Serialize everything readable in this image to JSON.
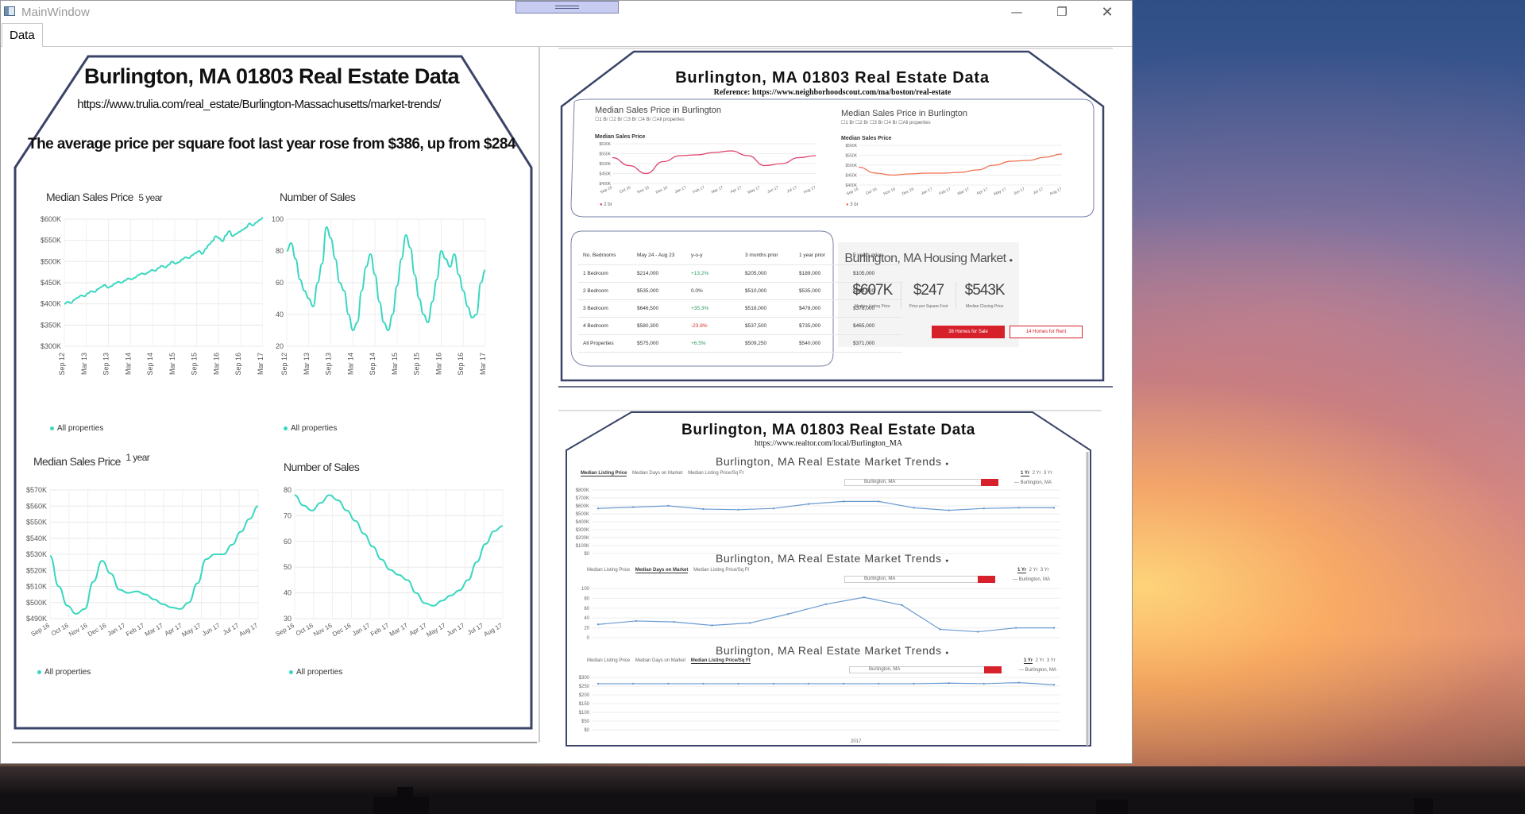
{
  "window": {
    "title": "MainWindow"
  },
  "tabs": [
    {
      "label": "Data"
    }
  ],
  "trulia": {
    "title": "Burlington, MA 01803 Real Estate Data",
    "url": "https://www.trulia.com/real_estate/Burlington-Massachusetts/market-trends/",
    "headline": "The average price per square foot last year rose from  $386, up from $284",
    "legend": "All properties",
    "charts": [
      {
        "title": "Median Sales Price",
        "subtitle": "5 year",
        "yticks": [
          "$600K",
          "$550K",
          "$500K",
          "$450K",
          "$400K",
          "$350K",
          "$300K"
        ],
        "xticks": [
          "Sep 12",
          "Mar 13",
          "Sep 13",
          "Mar 14",
          "Sep 14",
          "Mar 15",
          "Sep 15",
          "Mar 16",
          "Sep 16",
          "Mar 17"
        ]
      },
      {
        "title": "Number of Sales",
        "subtitle": "",
        "yticks": [
          "100",
          "80",
          "60",
          "40",
          "20"
        ],
        "xticks": [
          "Sep 12",
          "Mar 13",
          "Sep 13",
          "Mar 14",
          "Sep 14",
          "Mar 15",
          "Sep 15",
          "Mar 16",
          "Sep 16",
          "Mar 17"
        ]
      },
      {
        "title": "Median Sales Price",
        "subtitle": "1 year",
        "yticks": [
          "$570K",
          "$560K",
          "$550K",
          "$540K",
          "$530K",
          "$520K",
          "$510K",
          "$500K",
          "$490K"
        ],
        "xticks": [
          "Sep 16",
          "Oct 16",
          "Nov 16",
          "Dec 16",
          "Jan 17",
          "Feb 17",
          "Mar 17",
          "Apr 17",
          "May 17",
          "Jun 17",
          "Jul 17",
          "Aug 17"
        ]
      },
      {
        "title": "Number of Sales",
        "subtitle": "",
        "yticks": [
          "80",
          "70",
          "60",
          "50",
          "40",
          "30"
        ],
        "xticks": [
          "Sep 16",
          "Oct 16",
          "Nov 16",
          "Dec 16",
          "Jan 17",
          "Feb 17",
          "Mar 17",
          "Apr 17",
          "May 17",
          "Jun 17",
          "Jul 17",
          "Aug 17"
        ]
      }
    ]
  },
  "neighborhoodscout": {
    "title": "Burlington, MA 01803 Real Estate Data",
    "reference": "Reference: https://www.neighborhoodscout.com/ma/boston/real-estate",
    "left_chart": {
      "title": "Median Sales Price in Burlington",
      "filters": "☐1 Br  ☐2 Br  ☐3 Br  ☐4 Br  ☐All properties",
      "sub": "Median Sales Price",
      "legend": "2 br"
    },
    "right_chart": {
      "title": "Median Sales Price in Burlington",
      "filters": "☐1 Br  ☐2 Br  ☐3 Br  ☐4 Br  ☐All properties",
      "sub": "Median Sales Price",
      "legend": "3 br"
    },
    "mini_yticks": [
      "$600K",
      "$550K",
      "$500K",
      "$450K",
      "$400K"
    ],
    "mini_xticks": [
      "Sep 16",
      "Oct 16",
      "Nov 16",
      "Dec 16",
      "Jan 17",
      "Feb 17",
      "Mar 17",
      "Apr 17",
      "May 17",
      "Jun 17",
      "Jul 17",
      "Aug 17"
    ],
    "table": {
      "headers": [
        "No. Bedrooms",
        "May 24 - Aug 23",
        "y-o-y",
        "3 months prior",
        "1 year prior",
        "5 years prior"
      ],
      "rows": [
        [
          "1 Bedroom",
          "$214,000",
          "+13.2%",
          "$205,000",
          "$189,000",
          "$105,000"
        ],
        [
          "2 Bedroom",
          "$535,000",
          "0.0%",
          "$510,000",
          "$535,000",
          "$344,000"
        ],
        [
          "3 Bedroom",
          "$646,500",
          "+35.3%",
          "$518,000",
          "$478,000",
          "$378,000"
        ],
        [
          "4 Bedroom",
          "$580,300",
          "-23.8%",
          "$537,500",
          "$735,000",
          "$465,000"
        ],
        [
          "All Properties",
          "$575,000",
          "+6.5%",
          "$509,250",
          "$540,000",
          "$371,000"
        ]
      ]
    },
    "market": {
      "title": "Burlington, MA Housing Market",
      "stats": [
        {
          "value": "$607K",
          "label": "Median Listing Price"
        },
        {
          "value": "$247",
          "label": "Price per Square Foot"
        },
        {
          "value": "$543K",
          "label": "Median Closing Price"
        }
      ],
      "sale_button": "38 Homes for Sale",
      "rent_button": "14 Homes for Rent"
    }
  },
  "realtor": {
    "title": "Burlington, MA 01803 Real Estate Data",
    "url": "https://www.realtor.com/local/Burlington_MA",
    "trend_title": "Burlington, MA Real Estate Market Trends",
    "tabs": [
      "Median Listing Price",
      "Median Days on Market",
      "Median Listing Price/Sq Ft"
    ],
    "range": [
      "1 Yr",
      "2 Yr",
      "3 Yr"
    ],
    "location": "Burlington, MA",
    "chart1_yticks": [
      "$800K",
      "$700K",
      "$600K",
      "$500K",
      "$400K",
      "$300K",
      "$200K",
      "$100K",
      "$0"
    ],
    "chart2_yticks": [
      "100",
      "80",
      "60",
      "40",
      "20",
      "0"
    ],
    "chart3_yticks": [
      "$300",
      "$250",
      "$200",
      "$150",
      "$100",
      "$50",
      "$0"
    ],
    "year_label": "2017"
  },
  "chart_data": [
    {
      "type": "line",
      "title": "Median Sales Price",
      "subtitle": "5 year",
      "series": [
        {
          "name": "All properties",
          "values": [
            400,
            405,
            402,
            410,
            415,
            420,
            418,
            425,
            430,
            428,
            435,
            440,
            445,
            438,
            442,
            448,
            452,
            450,
            455,
            460,
            458,
            462,
            468,
            472,
            470,
            475,
            480,
            478,
            485,
            490,
            486,
            492,
            500,
            495,
            498,
            505,
            510,
            508,
            515,
            520,
            525,
            518,
            530,
            540,
            548,
            560,
            555,
            548,
            562,
            572,
            560,
            565,
            570,
            575,
            580,
            590,
            585,
            592,
            598,
            603
          ]
        }
      ],
      "ylim": [
        300,
        600
      ],
      "color": "#39d7c0"
    },
    {
      "type": "line",
      "title": "Number of Sales",
      "series": [
        {
          "name": "All properties",
          "values": [
            80,
            85,
            75,
            62,
            55,
            50,
            45,
            60,
            72,
            95,
            88,
            75,
            60,
            55,
            40,
            30,
            35,
            55,
            70,
            78,
            65,
            48,
            35,
            30,
            40,
            58,
            75,
            90,
            82,
            65,
            50,
            40,
            35,
            48,
            62,
            80,
            75,
            70,
            78,
            65,
            55,
            45,
            38,
            40,
            60,
            68
          ]
        }
      ],
      "ylim": [
        20,
        100
      ],
      "color": "#39d7c0"
    },
    {
      "type": "line",
      "title": "Median Sales Price",
      "subtitle": "1 year",
      "series": [
        {
          "name": "All properties",
          "values": [
            529,
            510,
            498,
            493,
            496,
            513,
            526,
            518,
            508,
            506,
            507,
            505,
            502,
            499,
            497,
            496,
            500,
            512,
            527,
            530,
            530,
            536,
            544,
            552,
            560
          ]
        }
      ],
      "ylim": [
        490,
        570
      ],
      "color": "#39d7c0"
    },
    {
      "type": "line",
      "title": "Number of Sales",
      "series": [
        {
          "name": "All properties",
          "values": [
            78,
            74,
            72,
            75,
            78,
            76,
            72,
            68,
            63,
            58,
            53,
            49,
            47,
            45,
            40,
            36,
            35,
            37,
            39,
            41,
            45,
            52,
            59,
            64,
            66
          ]
        }
      ],
      "ylim": [
        30,
        80
      ],
      "color": "#39d7c0"
    }
  ]
}
